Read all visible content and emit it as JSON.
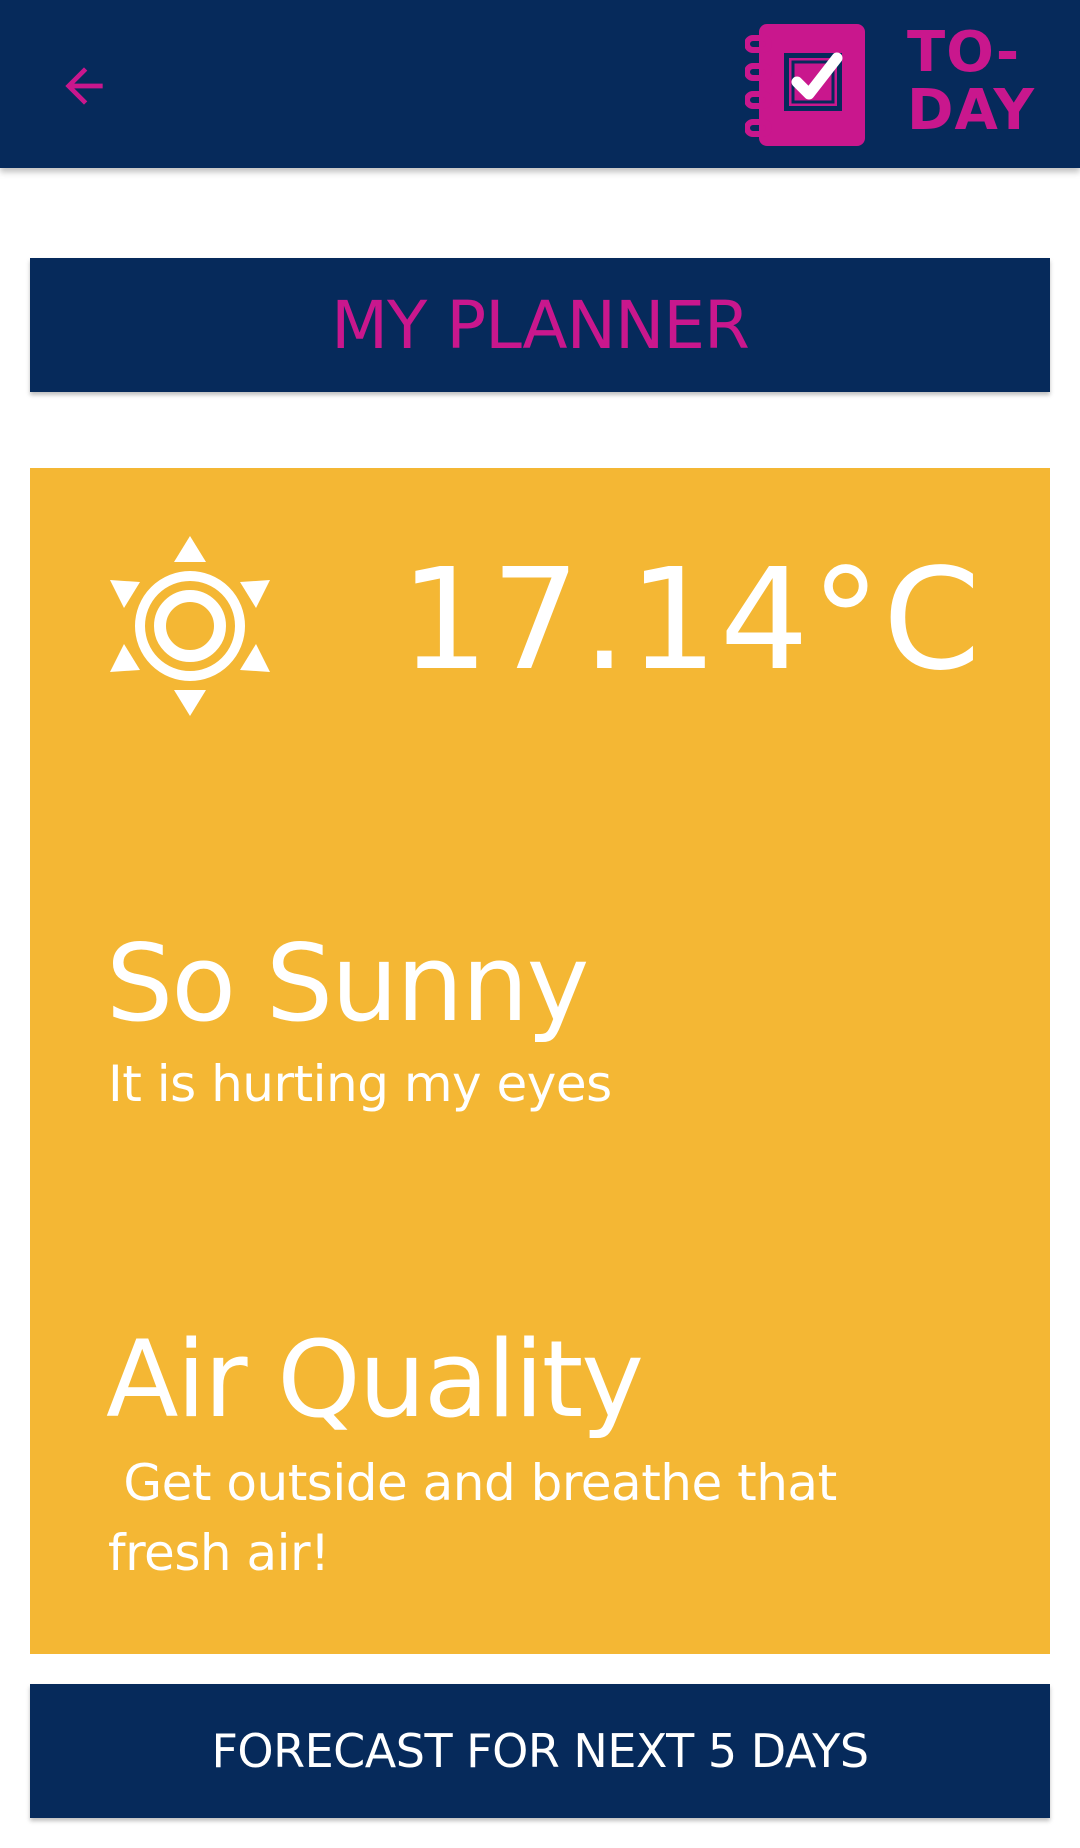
{
  "appbar": {
    "back_icon": "arrow-left-icon",
    "logo_icon": "notebook-check-icon",
    "logo_line1": "TO-",
    "logo_line2": "DAY"
  },
  "planner": {
    "title": "MY PLANNER"
  },
  "weather": {
    "icon": "sun-icon",
    "temperature": "17.14°C",
    "condition_title": "So Sunny",
    "condition_desc": "It is hurting my eyes",
    "air_title": "Air Quality",
    "air_desc": " Get outside and breathe that fresh air!"
  },
  "forecast": {
    "label": "FORECAST FOR NEXT 5 DAYS"
  },
  "colors": {
    "navy": "#062a5b",
    "magenta": "#c9178d",
    "card_yellow": "#f4b734",
    "white": "#ffffff"
  }
}
